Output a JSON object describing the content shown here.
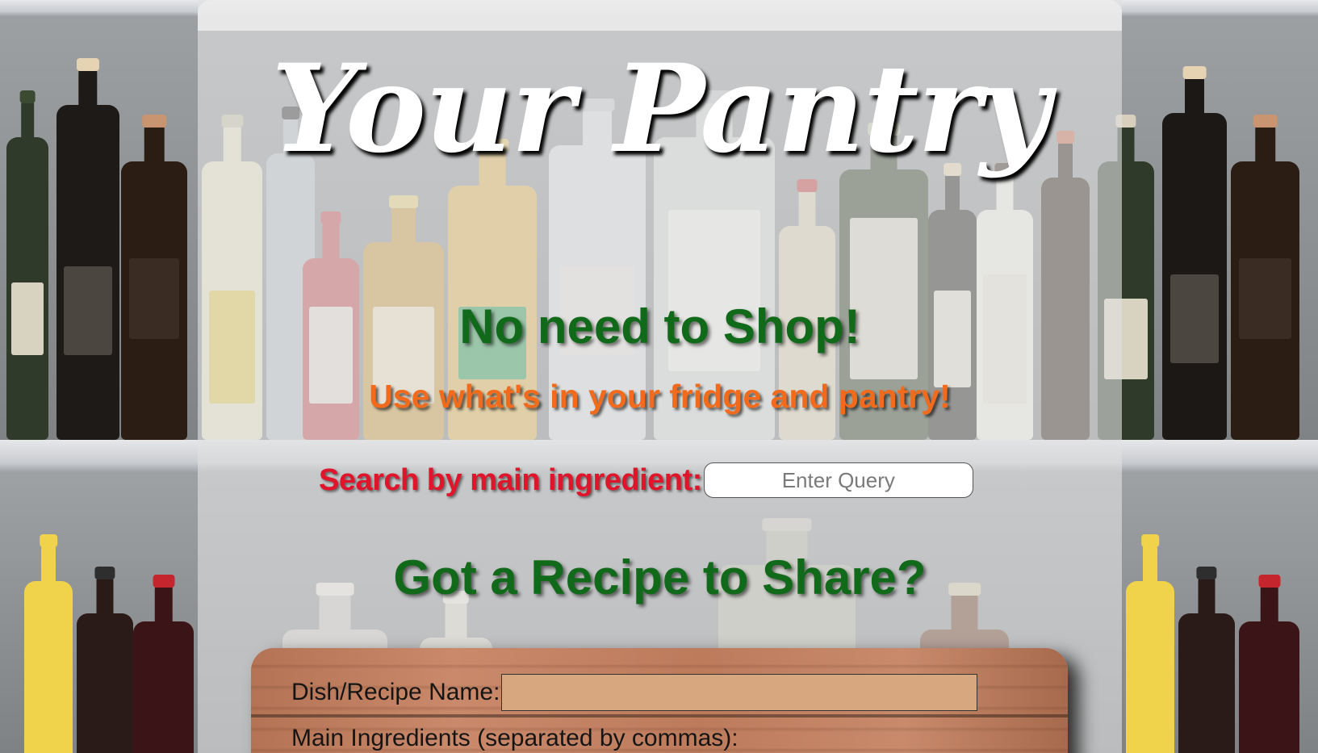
{
  "header": {
    "title": "Your Pantry"
  },
  "hero": {
    "headline": "No need to Shop!",
    "subheadline": "Use what's in your fridge and pantry!"
  },
  "search": {
    "label": "Search by main ingredient:",
    "placeholder": "Enter Query",
    "value": ""
  },
  "share": {
    "heading": "Got a Recipe to Share?",
    "dish_label": "Dish/Recipe Name:",
    "dish_value": "",
    "ingredients_label": "Main Ingredients (separated by commas):"
  },
  "colors": {
    "title": "#ffffff",
    "headline": "#116a19",
    "subheadline": "#f26b1d",
    "search_label": "#e0142a",
    "form_board": "#c0805f",
    "dish_input": "#d7a87f"
  }
}
